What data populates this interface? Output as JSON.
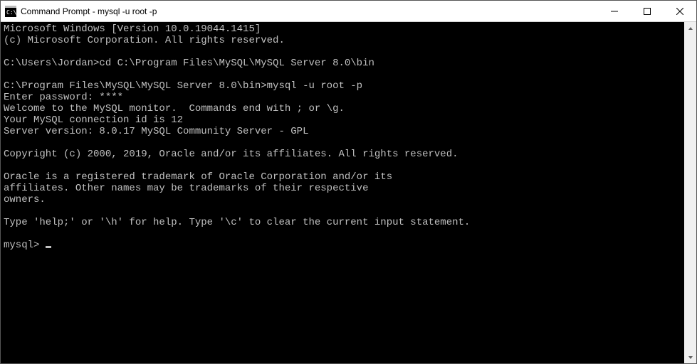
{
  "window": {
    "title": "Command Prompt - mysql  -u root -p"
  },
  "terminal": {
    "lines": [
      "Microsoft Windows [Version 10.0.19044.1415]",
      "(c) Microsoft Corporation. All rights reserved.",
      "",
      "C:\\Users\\Jordan>cd C:\\Program Files\\MySQL\\MySQL Server 8.0\\bin",
      "",
      "C:\\Program Files\\MySQL\\MySQL Server 8.0\\bin>mysql -u root -p",
      "Enter password: ****",
      "Welcome to the MySQL monitor.  Commands end with ; or \\g.",
      "Your MySQL connection id is 12",
      "Server version: 8.0.17 MySQL Community Server - GPL",
      "",
      "Copyright (c) 2000, 2019, Oracle and/or its affiliates. All rights reserved.",
      "",
      "Oracle is a registered trademark of Oracle Corporation and/or its",
      "affiliates. Other names may be trademarks of their respective",
      "owners.",
      "",
      "Type 'help;' or '\\h' for help. Type '\\c' to clear the current input statement.",
      "",
      "mysql> "
    ]
  }
}
